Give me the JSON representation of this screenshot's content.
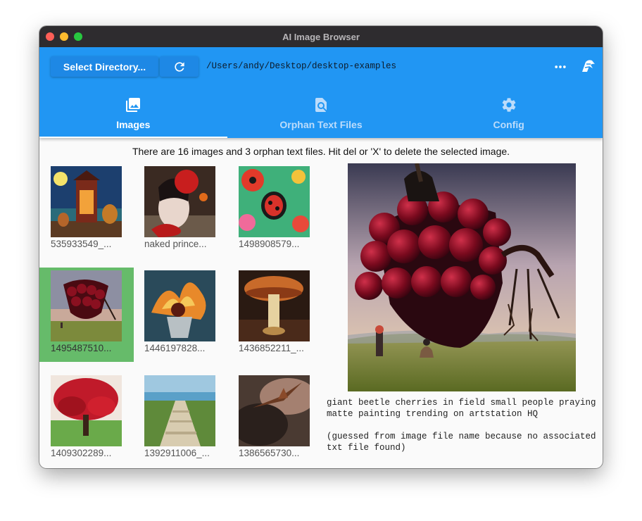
{
  "window": {
    "title": "AI Image Browser"
  },
  "toolbar": {
    "select_label": "Select Directory...",
    "refresh_icon": "refresh-icon",
    "path": "/Users/andy/Desktop/desktop-examples",
    "more_icon": "more-horizontal-icon",
    "logo_icon": "app-logo-icon"
  },
  "tabs": [
    {
      "label": "Images",
      "icon": "photo-library-icon",
      "active": true
    },
    {
      "label": "Orphan Text Files",
      "icon": "find-in-page-icon",
      "active": false
    },
    {
      "label": "Config",
      "icon": "gear-icon",
      "active": false
    }
  ],
  "info_text": "There are 16 images and 3 orphan text files. Hit del or 'X' to delete the selected image.",
  "images": [
    {
      "caption": "535933549_..."
    },
    {
      "caption": "naked prince..."
    },
    {
      "caption": "1498908579..."
    },
    {
      "caption": "1495487510...",
      "selected": true
    },
    {
      "caption": "1446197828..."
    },
    {
      "caption": "1436852211_..."
    },
    {
      "caption": "1409302289..."
    },
    {
      "caption": "1392911006_..."
    },
    {
      "caption": "1386565730..."
    }
  ],
  "preview": {
    "description": "giant beetle cherries in field small people praying matte painting trending on artstation HQ",
    "note": "(guessed from image file name because no associated txt file found)"
  },
  "colors": {
    "accent": "#2196f3",
    "button": "#1e88e5",
    "selected_tile": "#66bb6a"
  }
}
